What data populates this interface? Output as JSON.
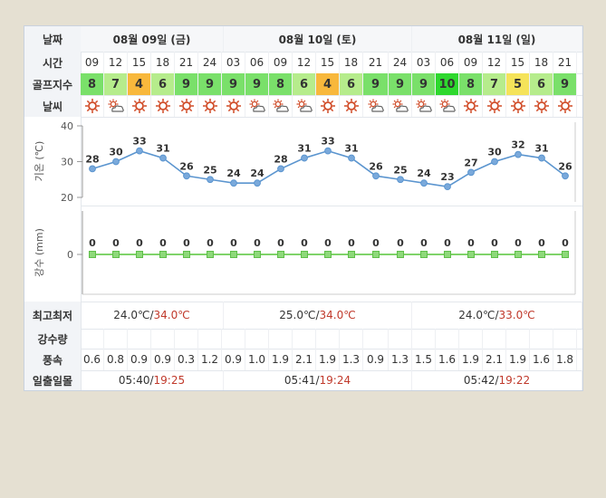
{
  "labels": {
    "date": "날짜",
    "time": "시간",
    "golf": "골프지수",
    "weather": "날씨",
    "max_min": "최고최저",
    "rain": "강수량",
    "wind": "풍속",
    "sun": "일출일몰"
  },
  "days": [
    {
      "date": "08월 09일 (금)",
      "min_temp": "24.0℃",
      "sep": "/",
      "max_temp": "34.0℃",
      "sunrise": "05:40",
      "sunset": "19:25"
    },
    {
      "date": "08월 10일 (토)",
      "min_temp": "25.0℃",
      "sep": "/",
      "max_temp": "34.0℃",
      "sunrise": "05:41",
      "sunset": "19:24"
    },
    {
      "date": "08월 11일 (일)",
      "min_temp": "24.0℃",
      "sep": "/",
      "max_temp": "33.0℃",
      "sunrise": "05:42",
      "sunset": "19:22"
    }
  ],
  "hours": [
    "09",
    "12",
    "15",
    "18",
    "21",
    "24",
    "03",
    "06",
    "09",
    "12",
    "15",
    "18",
    "21",
    "24",
    "03",
    "06",
    "09",
    "12",
    "15",
    "18",
    "21"
  ],
  "golf_index": [
    "8",
    "7",
    "4",
    "6",
    "9",
    "9",
    "9",
    "9",
    "8",
    "6",
    "4",
    "6",
    "9",
    "9",
    "9",
    "10",
    "8",
    "7",
    "5",
    "6",
    "9"
  ],
  "weather_icons": [
    "sun-icon",
    "partly-cloudy-icon",
    "sun-icon",
    "sun-icon",
    "sun-icon",
    "sun-icon",
    "sun-icon",
    "partly-cloudy-icon",
    "partly-cloudy-icon",
    "partly-cloudy-icon",
    "sun-icon",
    "sun-icon",
    "partly-cloudy-icon",
    "partly-cloudy-icon",
    "partly-cloudy-icon",
    "partly-cloudy-icon",
    "sun-icon",
    "sun-icon",
    "sun-icon",
    "sun-icon",
    "sun-icon"
  ],
  "wind": [
    "0.6",
    "0.8",
    "0.9",
    "0.9",
    "0.3",
    "1.2",
    "0.9",
    "1.0",
    "1.9",
    "2.1",
    "1.9",
    "1.3",
    "0.9",
    "1.3",
    "1.5",
    "1.6",
    "1.9",
    "2.1",
    "1.9",
    "1.6",
    "1.8"
  ],
  "colors": {
    "golf_green": "#7ae06a",
    "golf_light_green": "#b6ec8c",
    "golf_orange": "#f8b83c",
    "golf_yellow": "#f5e35a",
    "golf_bright_green": "#2ed82e",
    "temp_line": "#5b95cf",
    "rain_line": "#7fd36a"
  },
  "chart_data": [
    {
      "type": "line",
      "ylabel": "기온 (℃)",
      "ylim": [
        20,
        40
      ],
      "yticks": [
        "40",
        "30",
        "20"
      ],
      "x": [
        "09",
        "12",
        "15",
        "18",
        "21",
        "24",
        "03",
        "06",
        "09",
        "12",
        "15",
        "18",
        "21",
        "24",
        "03",
        "06",
        "09",
        "12",
        "15",
        "18",
        "21"
      ],
      "values": [
        28,
        30,
        33,
        31,
        26,
        25,
        24,
        24,
        28,
        31,
        33,
        31,
        26,
        25,
        24,
        23,
        27,
        30,
        32,
        31,
        26
      ]
    },
    {
      "type": "line",
      "ylabel": "강수 (mm)",
      "ytick": "0",
      "x": [
        "09",
        "12",
        "15",
        "18",
        "21",
        "24",
        "03",
        "06",
        "09",
        "12",
        "15",
        "18",
        "21",
        "24",
        "03",
        "06",
        "09",
        "12",
        "15",
        "18",
        "21"
      ],
      "values": [
        0,
        0,
        0,
        0,
        0,
        0,
        0,
        0,
        0,
        0,
        0,
        0,
        0,
        0,
        0,
        0,
        0,
        0,
        0,
        0,
        0
      ]
    }
  ]
}
